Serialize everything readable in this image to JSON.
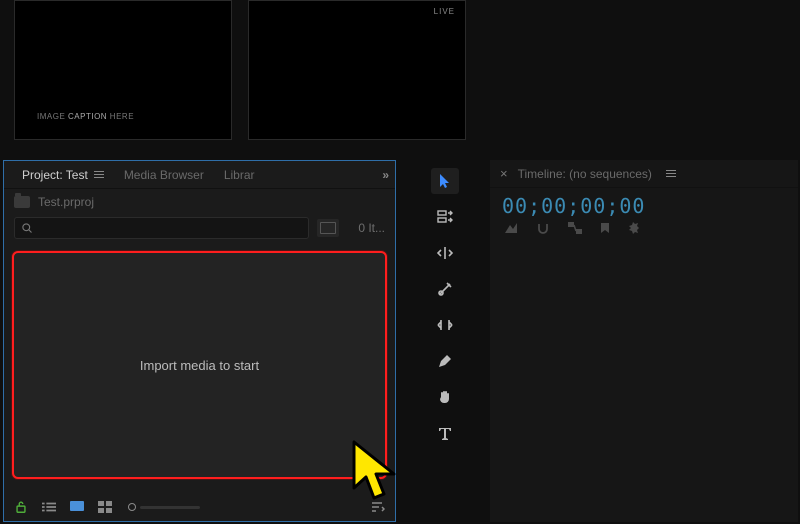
{
  "previews": {
    "left_caption_a": "IMAGE ",
    "left_caption_b": "CAPTION",
    "left_caption_c": " HERE",
    "right_badge": "LIVE"
  },
  "project": {
    "tabs": {
      "active": "Project: Test",
      "media_browser": "Media Browser",
      "libraries": "Librar"
    },
    "file": "Test.prproj",
    "search_placeholder": "",
    "item_count": "0 It...",
    "drop_text": "Import media to start"
  },
  "timeline": {
    "title": "Timeline: (no sequences)",
    "timecode": "00;00;00;00"
  },
  "icons": {
    "lock": "lock-open",
    "list": "list",
    "icons": "icons",
    "freeform": "freeform",
    "zoom": "zoom",
    "sort": "sort",
    "newbin": "new-bin",
    "newitem": "new-item",
    "trash": "trash"
  }
}
